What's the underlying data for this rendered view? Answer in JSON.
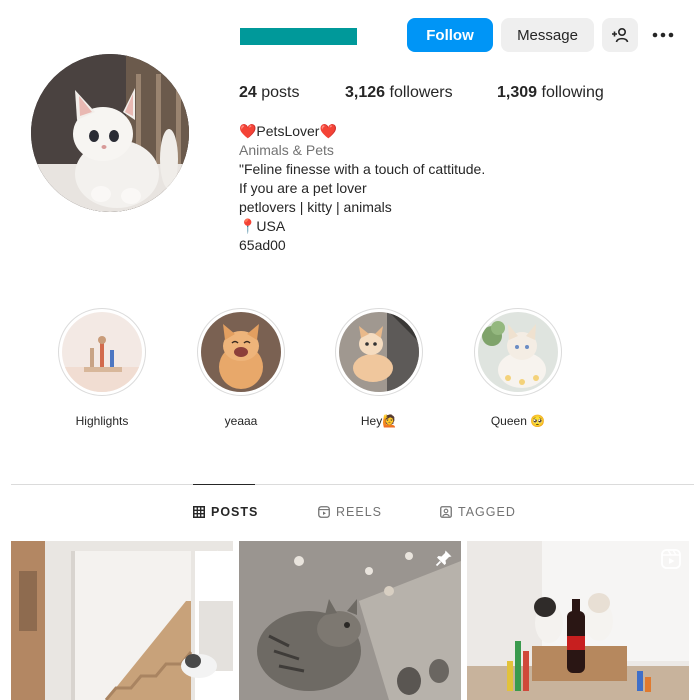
{
  "profile": {
    "username_redaction_color": "#00999a",
    "display_name": "❤️PetsLover❤️",
    "category": "Animals & Pets",
    "bio_lines": [
      "\"Feline finesse with a touch of cattitude.",
      "If you are a pet lover",
      "petlovers | kitty | animals",
      "📍USA",
      "65ad00"
    ]
  },
  "actions": {
    "follow_label": "Follow",
    "message_label": "Message",
    "follow_color": "#0095f6",
    "add_user_icon": "add-user-icon",
    "more_icon": "more-options-icon"
  },
  "stats": {
    "posts_count": "24",
    "posts_label": "posts",
    "followers_count": "3,126",
    "followers_label": "followers",
    "following_count": "1,309",
    "following_label": "following"
  },
  "highlights": [
    {
      "label": "Highlights"
    },
    {
      "label": "yeaaa"
    },
    {
      "label": "Hey🙋"
    },
    {
      "label": "Queen 🥺"
    }
  ],
  "tabs": {
    "posts": "POSTS",
    "reels": "REELS",
    "tagged": "TAGGED",
    "active": "POSTS"
  },
  "grid": [
    {
      "badge_icon": "pin-icon"
    },
    {
      "badge_icon": "pin-icon"
    },
    {
      "badge_icon": "reels-icon"
    }
  ]
}
